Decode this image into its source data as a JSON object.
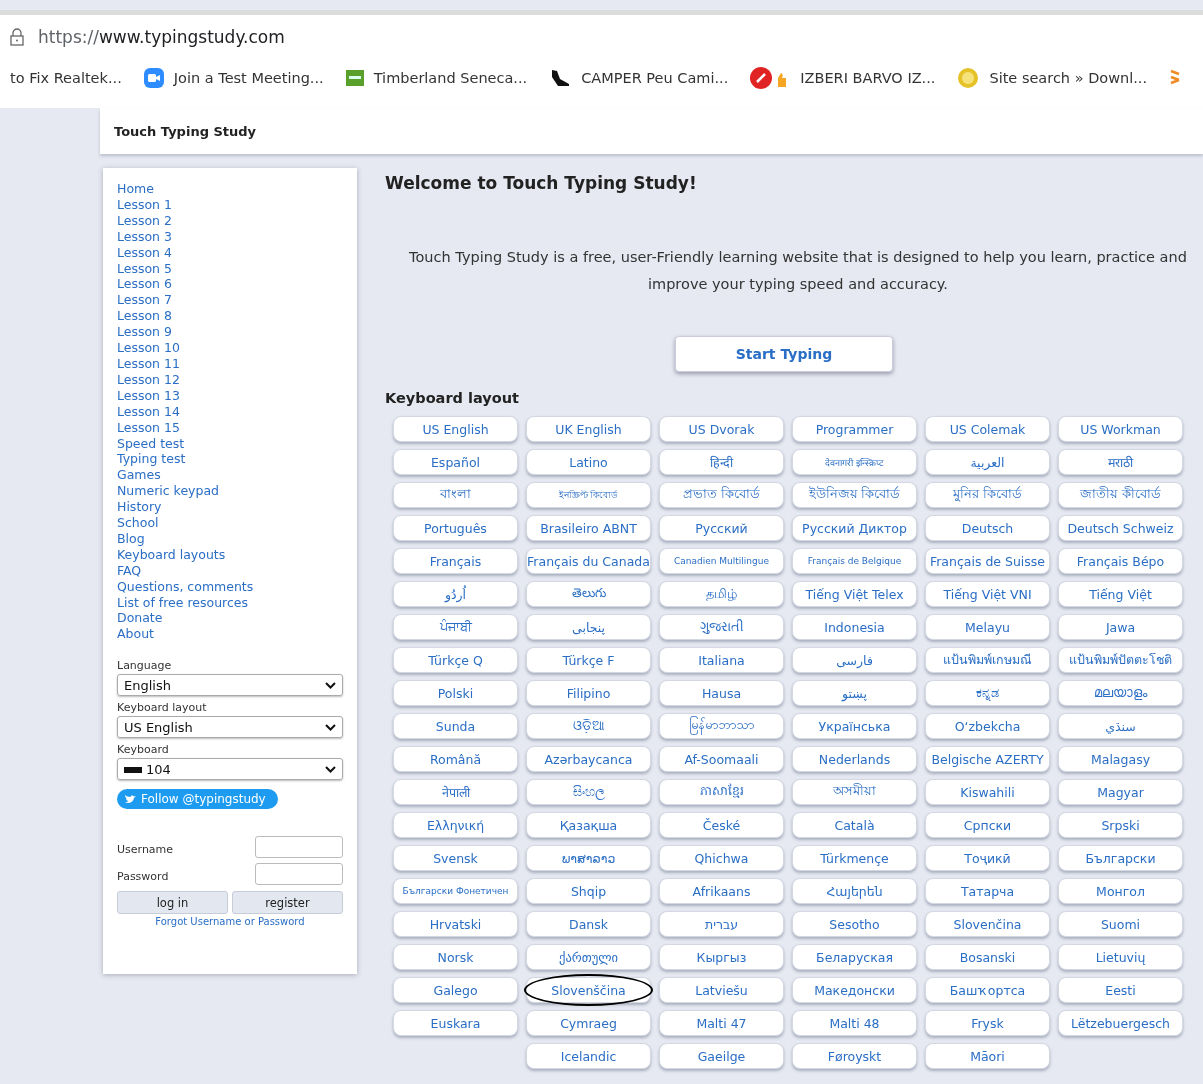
{
  "browser": {
    "url_prefix": "https://",
    "url_host": "www.typingstudy.com",
    "bookmarks": [
      "to Fix Realtek...",
      "Join a Test Meeting...",
      "Timberland Seneca...",
      "CAMPER Peu Cami...",
      "IZBERI BARVO IZ...",
      "Site search » Downl..."
    ]
  },
  "site_title": "Touch Typing Study",
  "sidebar": {
    "links": [
      "Home",
      "Lesson 1",
      "Lesson 2",
      "Lesson 3",
      "Lesson 4",
      "Lesson 5",
      "Lesson 6",
      "Lesson 7",
      "Lesson 8",
      "Lesson 9",
      "Lesson 10",
      "Lesson 11",
      "Lesson 12",
      "Lesson 13",
      "Lesson 14",
      "Lesson 15",
      "Speed test",
      "Typing test",
      "Games",
      "Numeric keypad",
      "History",
      "School",
      "Blog",
      "Keyboard layouts",
      "FAQ",
      "Questions, comments",
      "List of free resources",
      "Donate",
      "About"
    ],
    "selects": [
      {
        "label": "Language",
        "value": "English"
      },
      {
        "label": "Keyboard layout",
        "value": "US English"
      },
      {
        "label": "Keyboard",
        "value": "104"
      }
    ],
    "follow": "Follow @typingstudy",
    "username_label": "Username",
    "password_label": "Password",
    "buttons": [
      "log in",
      "register"
    ],
    "forgot": "Forgot Username or Password"
  },
  "main": {
    "title": "Welcome to Touch Typing Study!",
    "intro": "Touch Typing Study is a free, user-Friendly learning website that is designed to help you learn, practice and improve your typing speed and accuracy.",
    "start": "Start Typing",
    "layouts_heading": "Keyboard layout",
    "layouts": [
      {
        "label": "US English",
        "circled": false
      },
      {
        "label": "UK English",
        "circled": false
      },
      {
        "label": "US Dvorak",
        "circled": false
      },
      {
        "label": "Programmer",
        "circled": false
      },
      {
        "label": "US Colemak",
        "circled": false
      },
      {
        "label": "US Workman",
        "circled": false
      },
      {
        "label": "Español",
        "circled": false
      },
      {
        "label": "Latino",
        "circled": false
      },
      {
        "label": "हिन्दी",
        "circled": false
      },
      {
        "label": "देवनागरी इन्स्क्रिप्ट",
        "circled": false
      },
      {
        "label": "العربية",
        "circled": false
      },
      {
        "label": "मराठी",
        "circled": false
      },
      {
        "label": "বাংলা",
        "circled": false
      },
      {
        "label": "ইনস্ক্রিপ্ট কিবোর্ড",
        "circled": false
      },
      {
        "label": "প্রভাত কিবোর্ড",
        "circled": false
      },
      {
        "label": "ইউনিজয় কিবোর্ড",
        "circled": false
      },
      {
        "label": "মুনির কিবোর্ড",
        "circled": false
      },
      {
        "label": "জাতীয় কীবোর্ড",
        "circled": false
      },
      {
        "label": "Português",
        "circled": false
      },
      {
        "label": "Brasileiro ABNT",
        "circled": false
      },
      {
        "label": "Русский",
        "circled": false
      },
      {
        "label": "Русский Диктор",
        "circled": false
      },
      {
        "label": "Deutsch",
        "circled": false
      },
      {
        "label": "Deutsch Schweiz",
        "circled": false
      },
      {
        "label": "Français",
        "circled": false
      },
      {
        "label": "Français du Canada",
        "circled": false
      },
      {
        "label": "Canadien Multilingue",
        "circled": false
      },
      {
        "label": "Français de Belgique",
        "circled": false
      },
      {
        "label": "Français de Suisse",
        "circled": false
      },
      {
        "label": "Français Bépo",
        "circled": false
      },
      {
        "label": "اُردُو",
        "circled": false
      },
      {
        "label": "తెలుగు",
        "circled": false
      },
      {
        "label": "தமிழ்",
        "circled": false
      },
      {
        "label": "Tiếng Việt Telex",
        "circled": false
      },
      {
        "label": "Tiếng Việt VNI",
        "circled": false
      },
      {
        "label": "Tiếng Việt",
        "circled": false
      },
      {
        "label": "ਪੰਜਾਬੀ",
        "circled": false
      },
      {
        "label": "پنجابی",
        "circled": false
      },
      {
        "label": "ગુજરાતી",
        "circled": false
      },
      {
        "label": "Indonesia",
        "circled": false
      },
      {
        "label": "Melayu",
        "circled": false
      },
      {
        "label": "Jawa",
        "circled": false
      },
      {
        "label": "Türkçe Q",
        "circled": false
      },
      {
        "label": "Türkçe F",
        "circled": false
      },
      {
        "label": "Italiana",
        "circled": false
      },
      {
        "label": "فارسی",
        "circled": false
      },
      {
        "label": "แป้นพิมพ์เกษมณี",
        "circled": false
      },
      {
        "label": "แป้นพิมพ์ปัตตะโชติ",
        "circled": false
      },
      {
        "label": "Polski",
        "circled": false
      },
      {
        "label": "Filipino",
        "circled": false
      },
      {
        "label": "Hausa",
        "circled": false
      },
      {
        "label": "پښتو",
        "circled": false
      },
      {
        "label": "ಕನ್ನಡ",
        "circled": false
      },
      {
        "label": "മലയാളം",
        "circled": false
      },
      {
        "label": "Sunda",
        "circled": false
      },
      {
        "label": "ଓଡ଼ିଆ",
        "circled": false
      },
      {
        "label": "မြန်မာဘာသာ",
        "circled": false
      },
      {
        "label": "Українська",
        "circled": false
      },
      {
        "label": "O‘zbekcha",
        "circled": false
      },
      {
        "label": "سنڌي",
        "circled": false
      },
      {
        "label": "Română",
        "circled": false
      },
      {
        "label": "Azərbaycanca",
        "circled": false
      },
      {
        "label": "Af-Soomaali",
        "circled": false
      },
      {
        "label": "Nederlands",
        "circled": false
      },
      {
        "label": "Belgische AZERTY",
        "circled": false
      },
      {
        "label": "Malagasy",
        "circled": false
      },
      {
        "label": "नेपाली",
        "circled": false
      },
      {
        "label": "සිංහල",
        "circled": false
      },
      {
        "label": "ភាសាខ្មែរ",
        "circled": false
      },
      {
        "label": "অসমীয়া",
        "circled": false
      },
      {
        "label": "Kiswahili",
        "circled": false
      },
      {
        "label": "Magyar",
        "circled": false
      },
      {
        "label": "Ελληνική",
        "circled": false
      },
      {
        "label": "Қазақша",
        "circled": false
      },
      {
        "label": "České",
        "circled": false
      },
      {
        "label": "Català",
        "circled": false
      },
      {
        "label": "Српски",
        "circled": false
      },
      {
        "label": "Srpski",
        "circled": false
      },
      {
        "label": "Svensk",
        "circled": false
      },
      {
        "label": "ພາສາລາວ",
        "circled": false
      },
      {
        "label": "Qhichwa",
        "circled": false
      },
      {
        "label": "Türkmençe",
        "circled": false
      },
      {
        "label": "Тоҷикӣ",
        "circled": false
      },
      {
        "label": "Български",
        "circled": false
      },
      {
        "label": "Български Фонетичен",
        "circled": false
      },
      {
        "label": "Shqip",
        "circled": false
      },
      {
        "label": "Afrikaans",
        "circled": false
      },
      {
        "label": "Հայերեն",
        "circled": false
      },
      {
        "label": "Татарча",
        "circled": false
      },
      {
        "label": "Монгол",
        "circled": false
      },
      {
        "label": "Hrvatski",
        "circled": false
      },
      {
        "label": "Dansk",
        "circled": false
      },
      {
        "label": "עברית",
        "circled": false
      },
      {
        "label": "Sesotho",
        "circled": false
      },
      {
        "label": "Slovenčina",
        "circled": false
      },
      {
        "label": "Suomi",
        "circled": false
      },
      {
        "label": "Norsk",
        "circled": false
      },
      {
        "label": "ქართული",
        "circled": false
      },
      {
        "label": "Кыргыз",
        "circled": false
      },
      {
        "label": "Беларуская",
        "circled": false
      },
      {
        "label": "Bosanski",
        "circled": false
      },
      {
        "label": "Lietuvių",
        "circled": false
      },
      {
        "label": "Galego",
        "circled": false
      },
      {
        "label": "Slovenščina",
        "circled": true
      },
      {
        "label": "Latviešu",
        "circled": false
      },
      {
        "label": "Македонски",
        "circled": false
      },
      {
        "label": "Башҡортса",
        "circled": false
      },
      {
        "label": "Eesti",
        "circled": false
      },
      {
        "label": "Euskara",
        "circled": false
      },
      {
        "label": "Cymraeg",
        "circled": false
      },
      {
        "label": "Malti 47",
        "circled": false
      },
      {
        "label": "Malti 48",
        "circled": false
      },
      {
        "label": "Frysk",
        "circled": false
      },
      {
        "label": "Lëtzebuergesch",
        "circled": false
      },
      {
        "label": "Icelandic",
        "circled": false
      },
      {
        "label": "Gaeilge",
        "circled": false
      },
      {
        "label": "Føroyskt",
        "circled": false
      },
      {
        "label": "Māori",
        "circled": false
      }
    ]
  }
}
